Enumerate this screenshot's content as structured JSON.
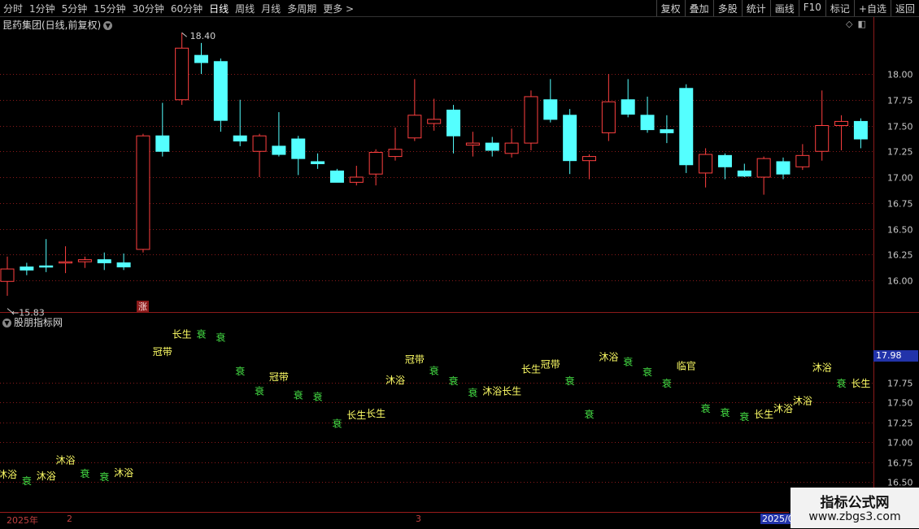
{
  "toolbar": {
    "periods": [
      "分时",
      "1分钟",
      "5分钟",
      "15分钟",
      "30分钟",
      "60分钟",
      "日线",
      "周线",
      "月线",
      "多周期",
      "更多 >"
    ],
    "active_period": "日线",
    "actions": [
      "复权",
      "叠加",
      "多股",
      "统计",
      "画线",
      "F10",
      "标记",
      "+自选",
      "返回"
    ]
  },
  "main_panel": {
    "title": "昆药集团(日线,前复权)",
    "dropdown_icon": "chevron-down-icon",
    "panel_icons": [
      "◇",
      "◧"
    ],
    "high_marker": "18.40",
    "low_marker": "15.83",
    "signal_badge": "涨"
  },
  "indicator_panel": {
    "title": "股朋指标网",
    "current_value": "17.98"
  },
  "bottom_axis": {
    "labels": [
      "2025年",
      "2",
      "3",
      "2025/0"
    ]
  },
  "watermark": {
    "title": "指标公式网",
    "url": "www.zbgs3.com"
  },
  "colors": {
    "up": "#ff4040",
    "down": "#54ffff",
    "grid": "#8b1a1a",
    "yellow_label": "#ffff66",
    "green_label": "#44dd44"
  },
  "chart_data": [
    {
      "type": "candlestick",
      "title": "昆药集团(日线,前复权)",
      "y_ticks": [
        "18.00",
        "17.75",
        "17.50",
        "17.25",
        "17.00",
        "16.75",
        "16.50",
        "16.25",
        "16.00"
      ],
      "ylim": [
        15.83,
        18.4
      ],
      "candles": [
        {
          "o": 15.99,
          "c": 16.11,
          "h": 16.23,
          "l": 15.85
        },
        {
          "o": 16.13,
          "c": 16.1,
          "h": 16.17,
          "l": 16.05
        },
        {
          "o": 16.14,
          "c": 16.13,
          "h": 16.4,
          "l": 16.08
        },
        {
          "o": 16.17,
          "c": 16.18,
          "h": 16.33,
          "l": 16.07
        },
        {
          "o": 16.18,
          "c": 16.2,
          "h": 16.23,
          "l": 16.12
        },
        {
          "o": 16.2,
          "c": 16.17,
          "h": 16.27,
          "l": 16.1
        },
        {
          "o": 16.17,
          "c": 16.13,
          "h": 16.26,
          "l": 16.1
        },
        {
          "o": 16.3,
          "c": 17.4,
          "h": 17.42,
          "l": 16.27
        },
        {
          "o": 17.4,
          "c": 17.25,
          "h": 17.72,
          "l": 17.2
        },
        {
          "o": 17.75,
          "c": 18.25,
          "h": 18.4,
          "l": 17.7
        },
        {
          "o": 18.18,
          "c": 18.11,
          "h": 18.3,
          "l": 18.0
        },
        {
          "o": 18.12,
          "c": 17.55,
          "h": 18.15,
          "l": 17.44
        },
        {
          "o": 17.4,
          "c": 17.35,
          "h": 17.75,
          "l": 17.3
        },
        {
          "o": 17.25,
          "c": 17.4,
          "h": 17.42,
          "l": 17.0
        },
        {
          "o": 17.3,
          "c": 17.22,
          "h": 17.63,
          "l": 17.2
        },
        {
          "o": 17.37,
          "c": 17.18,
          "h": 17.4,
          "l": 17.02
        },
        {
          "o": 17.15,
          "c": 17.13,
          "h": 17.23,
          "l": 17.08
        },
        {
          "o": 17.06,
          "c": 16.95,
          "h": 17.08,
          "l": 16.95
        },
        {
          "o": 16.95,
          "c": 17.0,
          "h": 17.11,
          "l": 16.92
        },
        {
          "o": 17.03,
          "c": 17.24,
          "h": 17.27,
          "l": 16.92
        },
        {
          "o": 17.2,
          "c": 17.27,
          "h": 17.48,
          "l": 17.16
        },
        {
          "o": 17.38,
          "c": 17.6,
          "h": 17.95,
          "l": 17.35
        },
        {
          "o": 17.52,
          "c": 17.56,
          "h": 17.76,
          "l": 17.45
        },
        {
          "o": 17.65,
          "c": 17.4,
          "h": 17.7,
          "l": 17.23
        },
        {
          "o": 17.31,
          "c": 17.33,
          "h": 17.44,
          "l": 17.2
        },
        {
          "o": 17.33,
          "c": 17.26,
          "h": 17.39,
          "l": 17.2
        },
        {
          "o": 17.23,
          "c": 17.33,
          "h": 17.47,
          "l": 17.19
        },
        {
          "o": 17.33,
          "c": 17.78,
          "h": 17.84,
          "l": 17.26
        },
        {
          "o": 17.75,
          "c": 17.56,
          "h": 17.95,
          "l": 17.53
        },
        {
          "o": 17.6,
          "c": 17.16,
          "h": 17.66,
          "l": 17.03
        },
        {
          "o": 17.16,
          "c": 17.2,
          "h": 17.22,
          "l": 16.98
        },
        {
          "o": 17.43,
          "c": 17.73,
          "h": 18.0,
          "l": 17.35
        },
        {
          "o": 17.75,
          "c": 17.61,
          "h": 17.95,
          "l": 17.58
        },
        {
          "o": 17.6,
          "c": 17.46,
          "h": 17.78,
          "l": 17.43
        },
        {
          "o": 17.46,
          "c": 17.43,
          "h": 17.6,
          "l": 17.33
        },
        {
          "o": 17.86,
          "c": 17.12,
          "h": 17.9,
          "l": 17.04
        },
        {
          "o": 17.04,
          "c": 17.22,
          "h": 17.28,
          "l": 16.9
        },
        {
          "o": 17.21,
          "c": 17.1,
          "h": 17.23,
          "l": 16.98
        },
        {
          "o": 17.06,
          "c": 17.01,
          "h": 17.13,
          "l": 17.0
        },
        {
          "o": 17.0,
          "c": 17.18,
          "h": 17.2,
          "l": 16.83
        },
        {
          "o": 17.15,
          "c": 17.03,
          "h": 17.19,
          "l": 16.98
        },
        {
          "o": 17.1,
          "c": 17.21,
          "h": 17.32,
          "l": 17.07
        },
        {
          "o": 17.25,
          "c": 17.5,
          "h": 17.84,
          "l": 17.16
        },
        {
          "o": 17.5,
          "c": 17.54,
          "h": 17.6,
          "l": 17.26
        },
        {
          "o": 17.54,
          "c": 17.37,
          "h": 17.57,
          "l": 17.28
        }
      ]
    },
    {
      "type": "scatter",
      "title": "股朋指标网",
      "y_ticks": [
        "17.75",
        "17.50",
        "17.25",
        "17.00",
        "16.75",
        "16.50"
      ],
      "ylim": [
        16.45,
        18.3
      ],
      "labels": [
        {
          "i": 0,
          "y": 16.55,
          "t": "沐浴",
          "c": "yellow"
        },
        {
          "i": 1,
          "y": 16.47,
          "t": "衰",
          "c": "green"
        },
        {
          "i": 2,
          "y": 16.53,
          "t": "沐浴",
          "c": "yellow"
        },
        {
          "i": 3,
          "y": 16.73,
          "t": "沐浴",
          "c": "yellow"
        },
        {
          "i": 4,
          "y": 16.56,
          "t": "衰",
          "c": "green"
        },
        {
          "i": 5,
          "y": 16.52,
          "t": "衰",
          "c": "green"
        },
        {
          "i": 6,
          "y": 16.57,
          "t": "沐浴",
          "c": "yellow"
        },
        {
          "i": 8,
          "y": 18.1,
          "t": "冠带",
          "c": "yellow"
        },
        {
          "i": 9,
          "y": 18.32,
          "t": "长生",
          "c": "yellow"
        },
        {
          "i": 10,
          "y": 18.32,
          "t": "衰",
          "c": "green"
        },
        {
          "i": 11,
          "y": 18.28,
          "t": "衰",
          "c": "green"
        },
        {
          "i": 12,
          "y": 17.85,
          "t": "衰",
          "c": "green"
        },
        {
          "i": 13,
          "y": 17.6,
          "t": "衰",
          "c": "green"
        },
        {
          "i": 14,
          "y": 17.78,
          "t": "冠带",
          "c": "yellow"
        },
        {
          "i": 15,
          "y": 17.55,
          "t": "衰",
          "c": "green"
        },
        {
          "i": 16,
          "y": 17.53,
          "t": "衰",
          "c": "green"
        },
        {
          "i": 17,
          "y": 17.19,
          "t": "衰",
          "c": "green"
        },
        {
          "i": 18,
          "y": 17.3,
          "t": "长生",
          "c": "yellow"
        },
        {
          "i": 19,
          "y": 17.32,
          "t": "长生",
          "c": "yellow"
        },
        {
          "i": 20,
          "y": 17.74,
          "t": "沐浴",
          "c": "yellow"
        },
        {
          "i": 21,
          "y": 18.0,
          "t": "冠带",
          "c": "yellow"
        },
        {
          "i": 22,
          "y": 17.86,
          "t": "衰",
          "c": "green"
        },
        {
          "i": 23,
          "y": 17.73,
          "t": "衰",
          "c": "green"
        },
        {
          "i": 24,
          "y": 17.58,
          "t": "衰",
          "c": "green"
        },
        {
          "i": 25,
          "y": 17.6,
          "t": "沐浴",
          "c": "yellow"
        },
        {
          "i": 26,
          "y": 17.6,
          "t": "长生",
          "c": "yellow"
        },
        {
          "i": 27,
          "y": 17.88,
          "t": "长生",
          "c": "yellow"
        },
        {
          "i": 28,
          "y": 17.94,
          "t": "冠带",
          "c": "yellow"
        },
        {
          "i": 29,
          "y": 17.73,
          "t": "衰",
          "c": "green"
        },
        {
          "i": 30,
          "y": 17.31,
          "t": "衰",
          "c": "green"
        },
        {
          "i": 31,
          "y": 18.03,
          "t": "沐浴",
          "c": "yellow"
        },
        {
          "i": 32,
          "y": 17.97,
          "t": "衰",
          "c": "green"
        },
        {
          "i": 33,
          "y": 17.84,
          "t": "衰",
          "c": "green"
        },
        {
          "i": 34,
          "y": 17.7,
          "t": "衰",
          "c": "green"
        },
        {
          "i": 35,
          "y": 17.92,
          "t": "临官",
          "c": "yellow"
        },
        {
          "i": 36,
          "y": 17.38,
          "t": "衰",
          "c": "green"
        },
        {
          "i": 37,
          "y": 17.33,
          "t": "衰",
          "c": "green"
        },
        {
          "i": 38,
          "y": 17.28,
          "t": "衰",
          "c": "green"
        },
        {
          "i": 39,
          "y": 17.31,
          "t": "长生",
          "c": "yellow"
        },
        {
          "i": 40,
          "y": 17.38,
          "t": "沐浴",
          "c": "yellow"
        },
        {
          "i": 41,
          "y": 17.48,
          "t": "沐浴",
          "c": "yellow"
        },
        {
          "i": 42,
          "y": 17.9,
          "t": "沐浴",
          "c": "yellow"
        },
        {
          "i": 43,
          "y": 17.7,
          "t": "衰",
          "c": "green"
        },
        {
          "i": 44,
          "y": 17.7,
          "t": "长生",
          "c": "yellow"
        }
      ]
    }
  ]
}
